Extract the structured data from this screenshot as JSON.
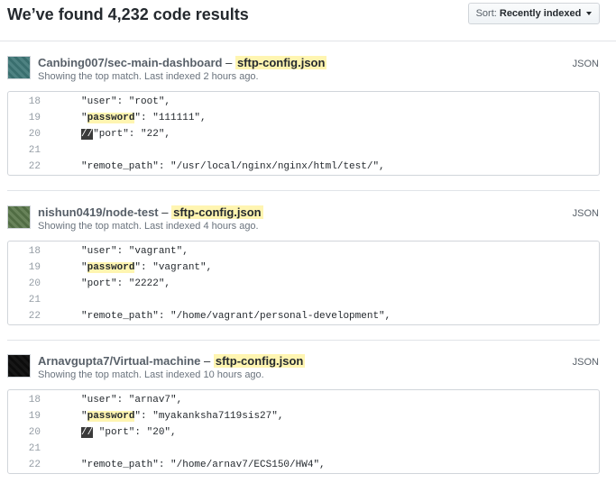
{
  "header": {
    "title": "We’ve found 4,232 code results",
    "sort_label": "Sort:",
    "sort_value": "Recently indexed"
  },
  "results": [
    {
      "repo": "Canbing007/sec-main-dashboard",
      "separator": "–",
      "file": "sftp-config.json",
      "meta": "Showing the top match. Last indexed 2 hours ago.",
      "language": "JSON",
      "avatar_colors": [
        "#d9ecec",
        "#9fc7c7",
        "#5c8d8d"
      ],
      "lines": [
        {
          "num": "18",
          "pre": "\"user\": \"root\",",
          "hl": "",
          "post": "",
          "cm": ""
        },
        {
          "num": "19",
          "pre": "\"",
          "hl": "password",
          "post": "\": \"111111\",",
          "cm": ""
        },
        {
          "num": "20",
          "pre": "",
          "hl": "",
          "post": "\"port\": \"22\",",
          "cm": "//"
        },
        {
          "num": "21",
          "pre": "",
          "hl": "",
          "post": "",
          "cm": ""
        },
        {
          "num": "22",
          "pre": "\"remote_path\": \"/usr/local/nginx/nginx/html/test/\",",
          "hl": "",
          "post": "",
          "cm": ""
        }
      ]
    },
    {
      "repo": "nishun0419/node-test",
      "separator": "–",
      "file": "sftp-config.json",
      "meta": "Showing the top match. Last indexed 4 hours ago.",
      "language": "JSON",
      "avatar_colors": [
        "#eef2ea",
        "#b8c8ae",
        "#6f8a62"
      ],
      "lines": [
        {
          "num": "18",
          "pre": "\"user\": \"vagrant\",",
          "hl": "",
          "post": "",
          "cm": ""
        },
        {
          "num": "19",
          "pre": "\"",
          "hl": "password",
          "post": "\": \"vagrant\",",
          "cm": ""
        },
        {
          "num": "20",
          "pre": "\"port\": \"2222\",",
          "hl": "",
          "post": "",
          "cm": ""
        },
        {
          "num": "21",
          "pre": "",
          "hl": "",
          "post": "",
          "cm": ""
        },
        {
          "num": "22",
          "pre": "\"remote_path\": \"/home/vagrant/personal-development\",",
          "hl": "",
          "post": "",
          "cm": ""
        }
      ]
    },
    {
      "repo": "Arnavgupta7/Virtual-machine",
      "separator": "–",
      "file": "sftp-config.json",
      "meta": "Showing the top match. Last indexed 10 hours ago.",
      "language": "JSON",
      "avatar_colors": [
        "#8a8a8a",
        "#4a4a4a",
        "#2a2a2a"
      ],
      "lines": [
        {
          "num": "18",
          "pre": "\"user\": \"arnav7\",",
          "hl": "",
          "post": "",
          "cm": ""
        },
        {
          "num": "19",
          "pre": "\"",
          "hl": "password",
          "post": "\": \"myakanksha7119sis27\",",
          "cm": ""
        },
        {
          "num": "20",
          "pre": "",
          "hl": "",
          "post": " \"port\": \"20\",",
          "cm": "//"
        },
        {
          "num": "21",
          "pre": "",
          "hl": "",
          "post": "",
          "cm": ""
        },
        {
          "num": "22",
          "pre": "\"remote_path\": \"/home/arnav7/ECS150/HW4\",",
          "hl": "",
          "post": "",
          "cm": ""
        }
      ]
    }
  ]
}
